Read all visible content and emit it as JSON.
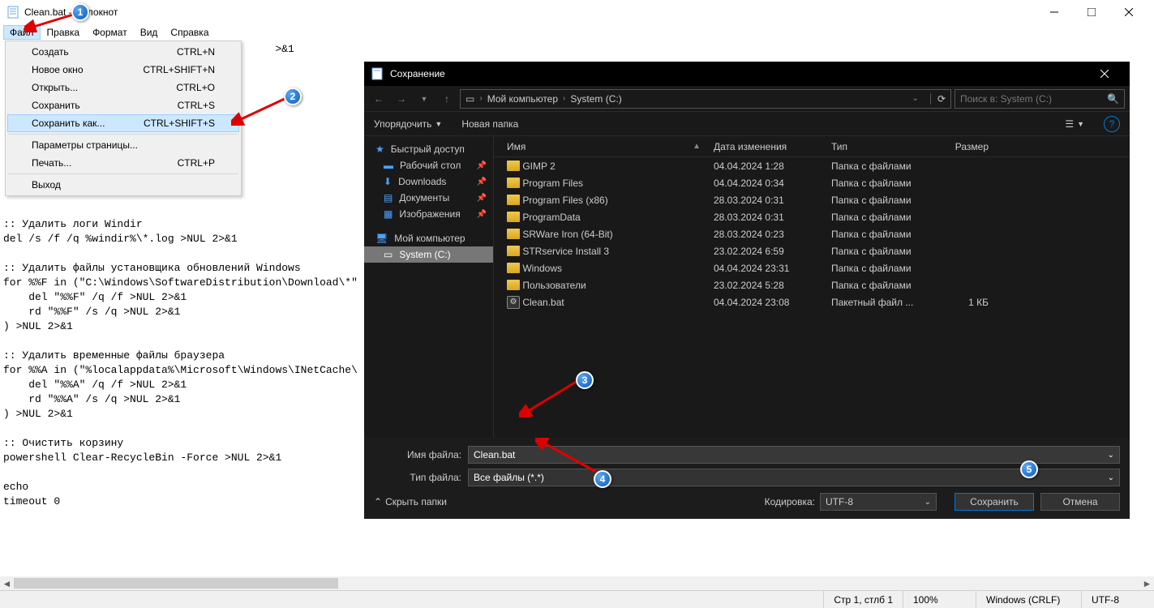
{
  "window": {
    "title": "Clean.bat — Блокнот"
  },
  "menubar": {
    "file": "Файл",
    "edit": "Правка",
    "format": "Формат",
    "view": "Вид",
    "help": "Справка"
  },
  "filemenu": {
    "items": [
      {
        "label": "Создать",
        "shortcut": "CTRL+N"
      },
      {
        "label": "Новое окно",
        "shortcut": "CTRL+SHIFT+N"
      },
      {
        "label": "Открыть...",
        "shortcut": "CTRL+O"
      },
      {
        "label": "Сохранить",
        "shortcut": "CTRL+S"
      },
      {
        "label": "Сохранить как...",
        "shortcut": "CTRL+SHIFT+S"
      },
      {
        "label": "Параметры страницы...",
        "shortcut": ""
      },
      {
        "label": "Печать...",
        "shortcut": "CTRL+P"
      },
      {
        "label": "Выход",
        "shortcut": ""
      }
    ]
  },
  "editor": {
    "content": "                                           >&1\n\n\n\n\n\n\n\n\n\n\n\n:: Удалить логи Windir\ndel /s /f /q %windir%\\*.log >NUL 2>&1\n\n:: Удалить файлы установщика обновлений Windows\nfor %%F in (\"C:\\Windows\\SoftwareDistribution\\Download\\*\"\n    del \"%%F\" /q /f >NUL 2>&1\n    rd \"%%F\" /s /q >NUL 2>&1\n) >NUL 2>&1\n\n:: Удалить временные файлы браузера\nfor %%A in (\"%localappdata%\\Microsoft\\Windows\\INetCache\\\n    del \"%%A\" /q /f >NUL 2>&1\n    rd \"%%A\" /s /q >NUL 2>&1\n) >NUL 2>&1\n\n:: Очистить корзину\npowershell Clear-RecycleBin -Force >NUL 2>&1\n\necho\ntimeout 0"
  },
  "statusbar": {
    "pos": "Стр 1, стлб 1",
    "zoom": "100%",
    "eol": "Windows (CRLF)",
    "enc": "UTF-8"
  },
  "savedlg": {
    "title": "Сохранение",
    "breadcrumb": {
      "root": "Мой компьютер",
      "drive": "System (C:)"
    },
    "search_placeholder": "Поиск в: System (C:)",
    "toolbar": {
      "organize": "Упорядочить",
      "newfolder": "Новая папка"
    },
    "nav": {
      "quick": "Быстрый доступ",
      "desktop": "Рабочий стол",
      "downloads": "Downloads",
      "documents": "Документы",
      "pictures": "Изображения",
      "computer": "Мой компьютер",
      "drive": "System (C:)"
    },
    "columns": {
      "name": "Имя",
      "date": "Дата изменения",
      "type": "Тип",
      "size": "Размер"
    },
    "files": [
      {
        "icon": "folder",
        "name": "GIMP 2",
        "date": "04.04.2024 1:28",
        "type": "Папка с файлами",
        "size": ""
      },
      {
        "icon": "folder",
        "name": "Program Files",
        "date": "04.04.2024 0:34",
        "type": "Папка с файлами",
        "size": ""
      },
      {
        "icon": "folder",
        "name": "Program Files (x86)",
        "date": "28.03.2024 0:31",
        "type": "Папка с файлами",
        "size": ""
      },
      {
        "icon": "folder",
        "name": "ProgramData",
        "date": "28.03.2024 0:31",
        "type": "Папка с файлами",
        "size": ""
      },
      {
        "icon": "folder",
        "name": "SRWare Iron (64-Bit)",
        "date": "28.03.2024 0:23",
        "type": "Папка с файлами",
        "size": ""
      },
      {
        "icon": "folder",
        "name": "STRservice Install 3",
        "date": "23.02.2024 6:59",
        "type": "Папка с файлами",
        "size": ""
      },
      {
        "icon": "folder",
        "name": "Windows",
        "date": "04.04.2024 23:31",
        "type": "Папка с файлами",
        "size": ""
      },
      {
        "icon": "folder",
        "name": "Пользователи",
        "date": "23.02.2024 5:28",
        "type": "Папка с файлами",
        "size": ""
      },
      {
        "icon": "bat",
        "name": "Clean.bat",
        "date": "04.04.2024 23:08",
        "type": "Пакетный файл ...",
        "size": "1 КБ"
      }
    ],
    "form": {
      "filename_label": "Имя файла:",
      "filename_value": "Clean.bat",
      "filetype_label": "Тип файла:",
      "filetype_value": "Все файлы  (*.*)",
      "hide": "Скрыть папки",
      "encoding_label": "Кодировка:",
      "encoding_value": "UTF-8",
      "save": "Сохранить",
      "cancel": "Отмена"
    }
  },
  "markers": {
    "m1": "1",
    "m2": "2",
    "m3": "3",
    "m4": "4",
    "m5": "5"
  }
}
